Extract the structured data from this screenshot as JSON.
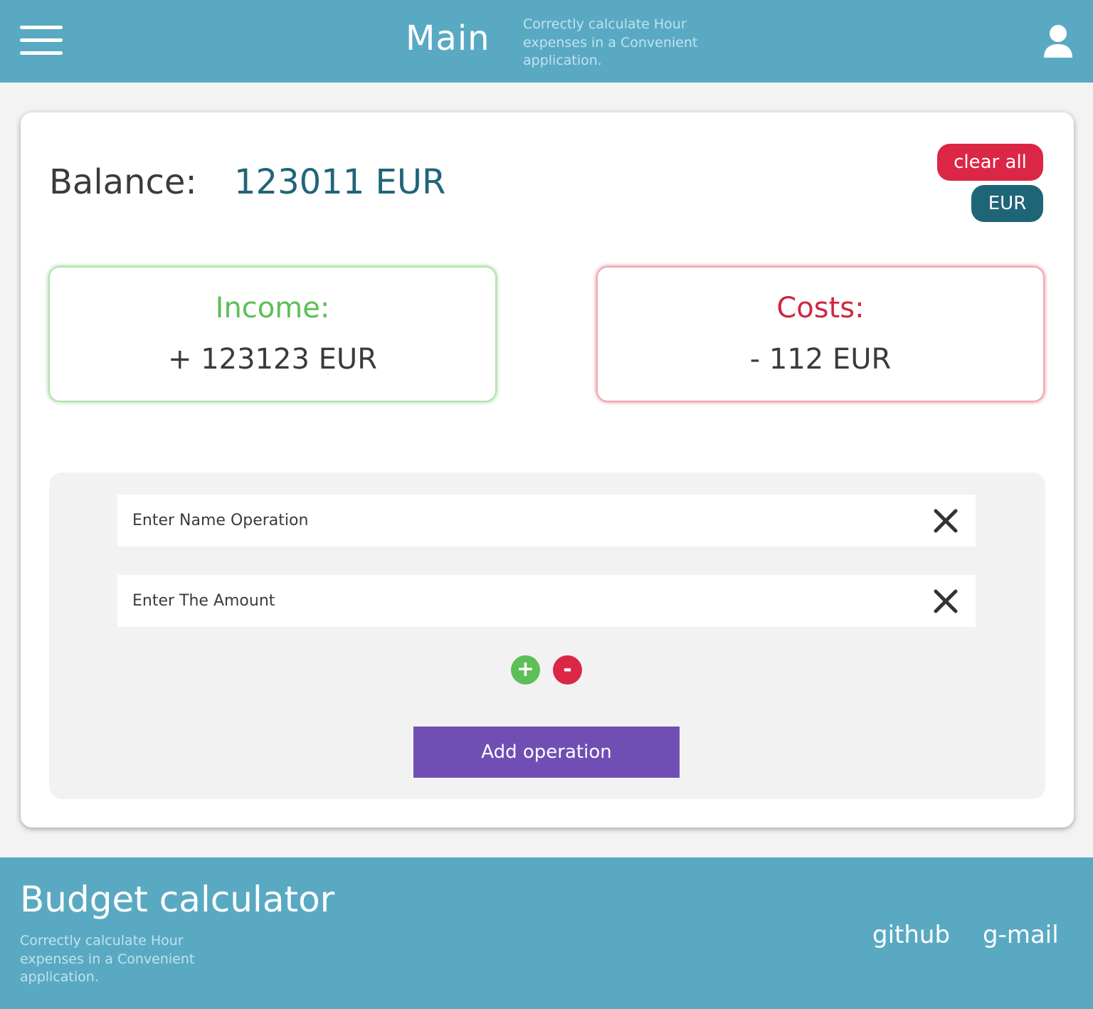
{
  "header": {
    "title": "Main",
    "tagline": "Correctly calculate Hour expenses in a Convenient application.",
    "menu_icon": "hamburger-menu-icon",
    "user_icon": "user-icon"
  },
  "balance": {
    "label": "Balance:",
    "value": "123011 EUR"
  },
  "actions": {
    "clear_all_label": "clear all",
    "currency_label": "EUR"
  },
  "income": {
    "label": "Income:",
    "value": "+ 123123 EUR"
  },
  "costs": {
    "label": "Costs:",
    "value": "- 112 EUR"
  },
  "form": {
    "name_placeholder": "Enter Name Operation",
    "amount_placeholder": "Enter The Amount",
    "plus_label": "+",
    "minus_label": "-",
    "add_label": "Add operation"
  },
  "footer": {
    "title": "Budget calculator",
    "tagline": "Correctly calculate Hour expenses in a Convenient application.",
    "links": [
      "github",
      "g-mail"
    ]
  },
  "colors": {
    "brand": "#5aa9c3",
    "income": "#5cbf57",
    "costs": "#dc2646",
    "accent": "#1f6578",
    "add_button": "#6f4fb4"
  }
}
